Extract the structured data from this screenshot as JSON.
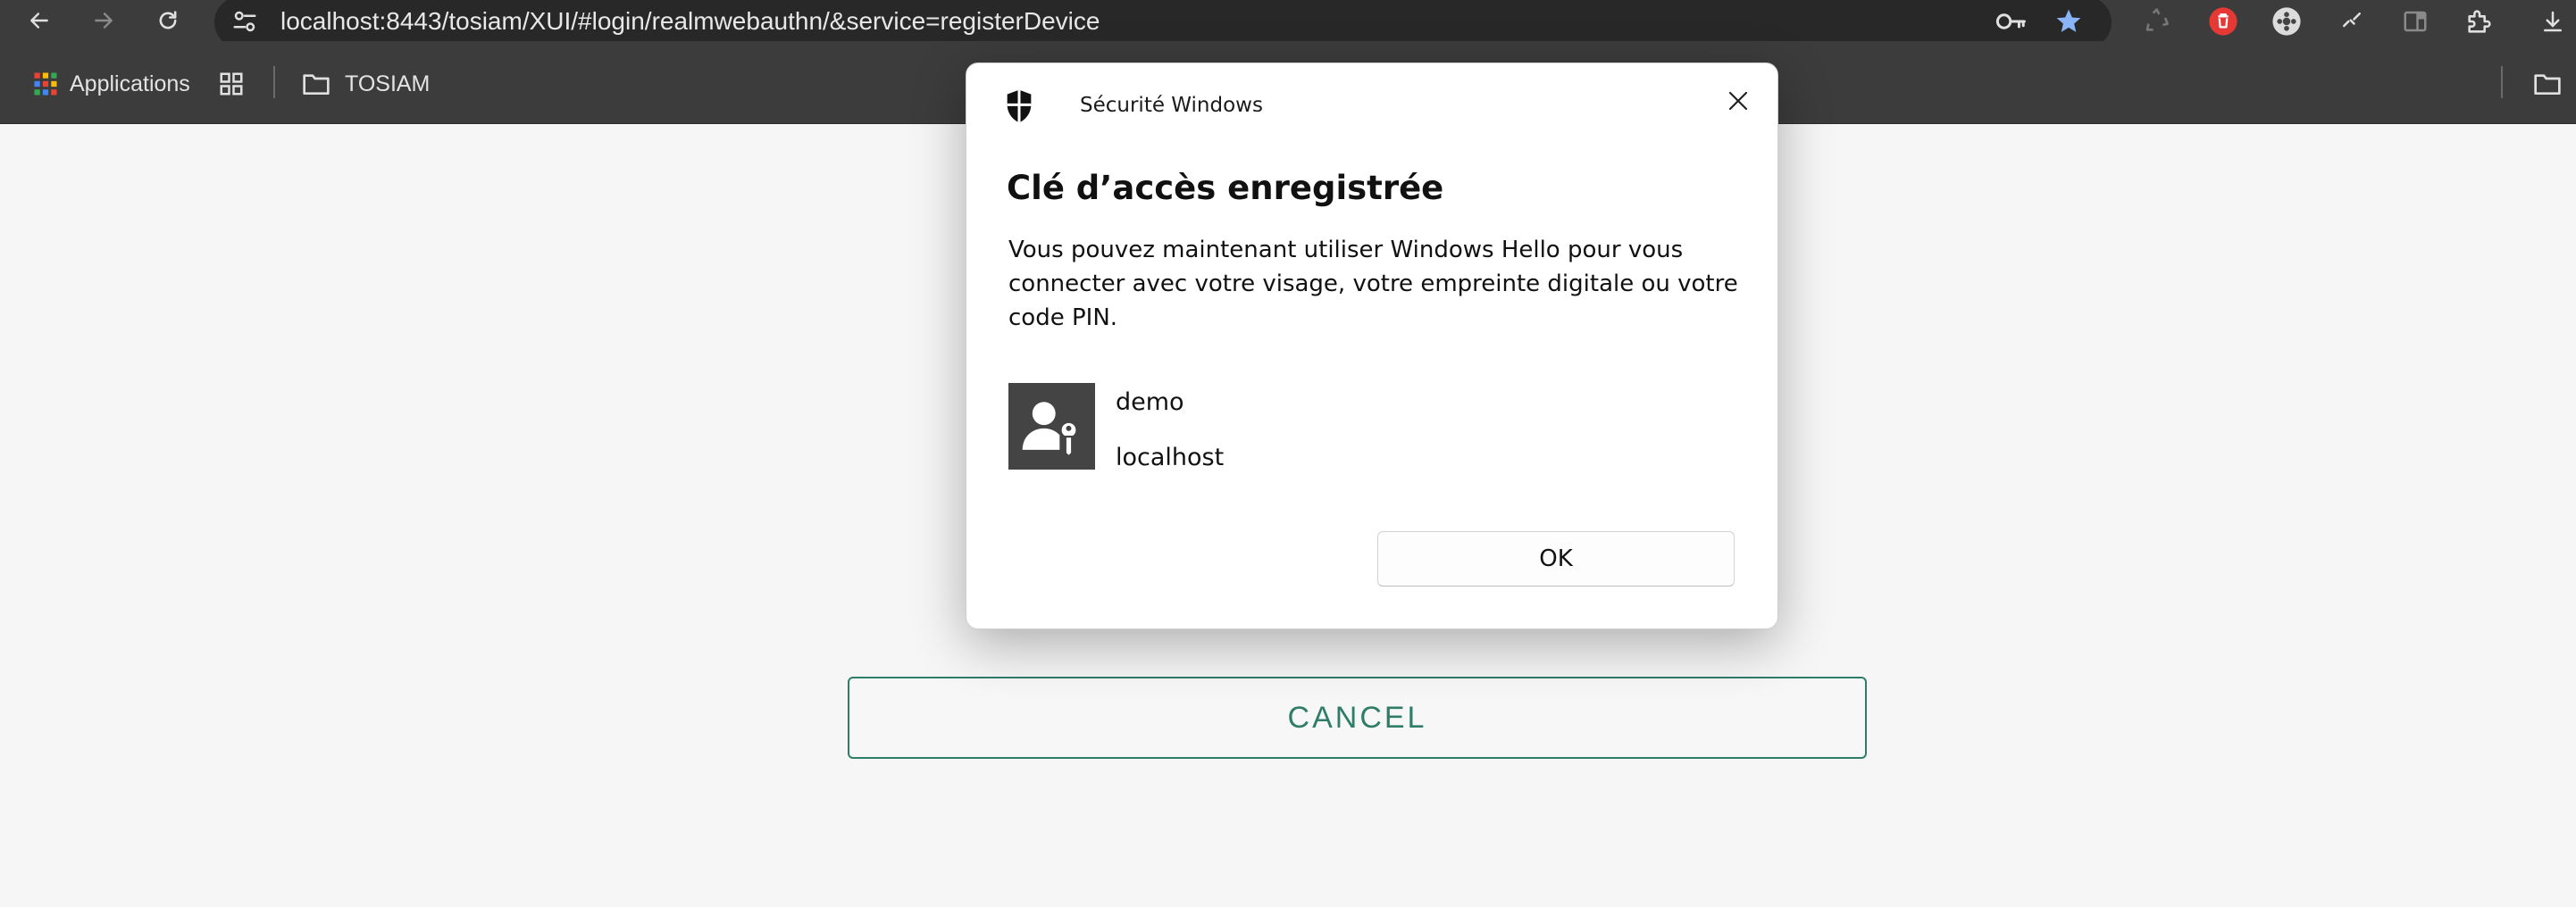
{
  "browser": {
    "url": "localhost:8443/tosiam/XUI/#login/realmwebauthn/&service=registerDevice",
    "bookmarks": {
      "apps_label": "Applications",
      "folder_label": "TOSIAM"
    }
  },
  "page": {
    "cancel_label": "CANCEL",
    "accent_color": "#2f7d68"
  },
  "dialog": {
    "app_name": "Sécurité Windows",
    "title": "Clé d’accès enregistrée",
    "body": "Vous pouvez maintenant utiliser Windows Hello pour vous connecter avec votre visage, votre empreinte digitale ou votre code PIN.",
    "username": "demo",
    "host": "localhost",
    "ok_label": "OK"
  },
  "icons": [
    "back-icon",
    "forward-icon",
    "reload-icon",
    "site-settings-icon",
    "key-icon",
    "star-icon",
    "extension-icons",
    "apps-grid-icon",
    "tab-groups-icon",
    "folder-icon",
    "shield-icon",
    "close-icon",
    "passkey-user-icon"
  ]
}
